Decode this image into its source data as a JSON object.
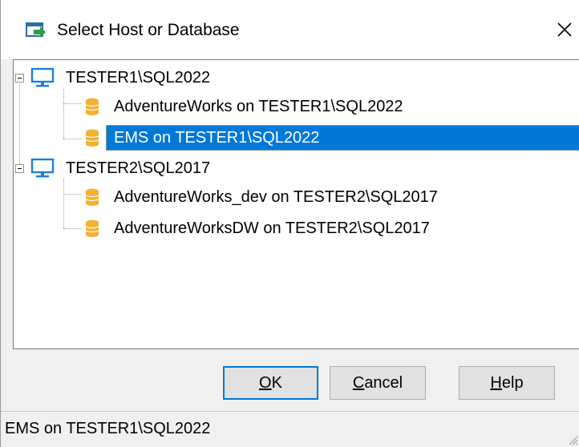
{
  "window": {
    "title": "Select Host or Database"
  },
  "tree": {
    "hosts": [
      {
        "label": "TESTER1\\SQL2022",
        "databases": [
          {
            "label": "AdventureWorks on TESTER1\\SQL2022",
            "selected": false
          },
          {
            "label": "EMS on TESTER1\\SQL2022",
            "selected": true
          }
        ]
      },
      {
        "label": "TESTER2\\SQL2017",
        "databases": [
          {
            "label": "AdventureWorks_dev on TESTER2\\SQL2017",
            "selected": false
          },
          {
            "label": "AdventureWorksDW on TESTER2\\SQL2017",
            "selected": false
          }
        ]
      }
    ]
  },
  "buttons": {
    "ok": {
      "mnemonic": "O",
      "rest": "K"
    },
    "cancel": {
      "mnemonic": "C",
      "rest": "ancel"
    },
    "help": {
      "mnemonic": "H",
      "rest": "elp"
    }
  },
  "status": {
    "text": "EMS on TESTER1\\SQL2022"
  },
  "colors": {
    "selection": "#0078d7",
    "db_icon": "#f2b233",
    "host_icon": "#1e7fd6"
  }
}
